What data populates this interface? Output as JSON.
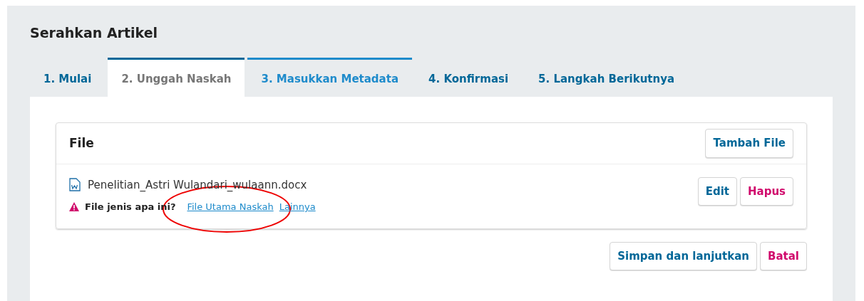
{
  "page_title": "Serahkan Artikel",
  "tabs": [
    {
      "label": "1. Mulai",
      "selected": false,
      "highlighted": false
    },
    {
      "label": "2. Unggah Naskah",
      "selected": true,
      "highlighted": false
    },
    {
      "label": "3. Masukkan Metadata",
      "selected": false,
      "highlighted": true
    },
    {
      "label": "4. Konfirmasi",
      "selected": false,
      "highlighted": false
    },
    {
      "label": "5. Langkah Berikutnya",
      "selected": false,
      "highlighted": false
    }
  ],
  "files_panel": {
    "title": "File",
    "add_button": "Tambah File",
    "files": [
      {
        "name": "Penelitian_Astri Wulandari_wulaann.docx",
        "warning": "File jenis apa ini?",
        "type_options": [
          "File Utama Naskah",
          "Lainnya"
        ],
        "circled": true,
        "actions": [
          {
            "label": "Edit",
            "kind": "normal"
          },
          {
            "label": "Hapus",
            "kind": "danger"
          }
        ]
      }
    ]
  },
  "form_buttons": [
    {
      "label": "Simpan dan lanjutkan",
      "kind": "normal"
    },
    {
      "label": "Batal",
      "kind": "danger"
    }
  ]
}
